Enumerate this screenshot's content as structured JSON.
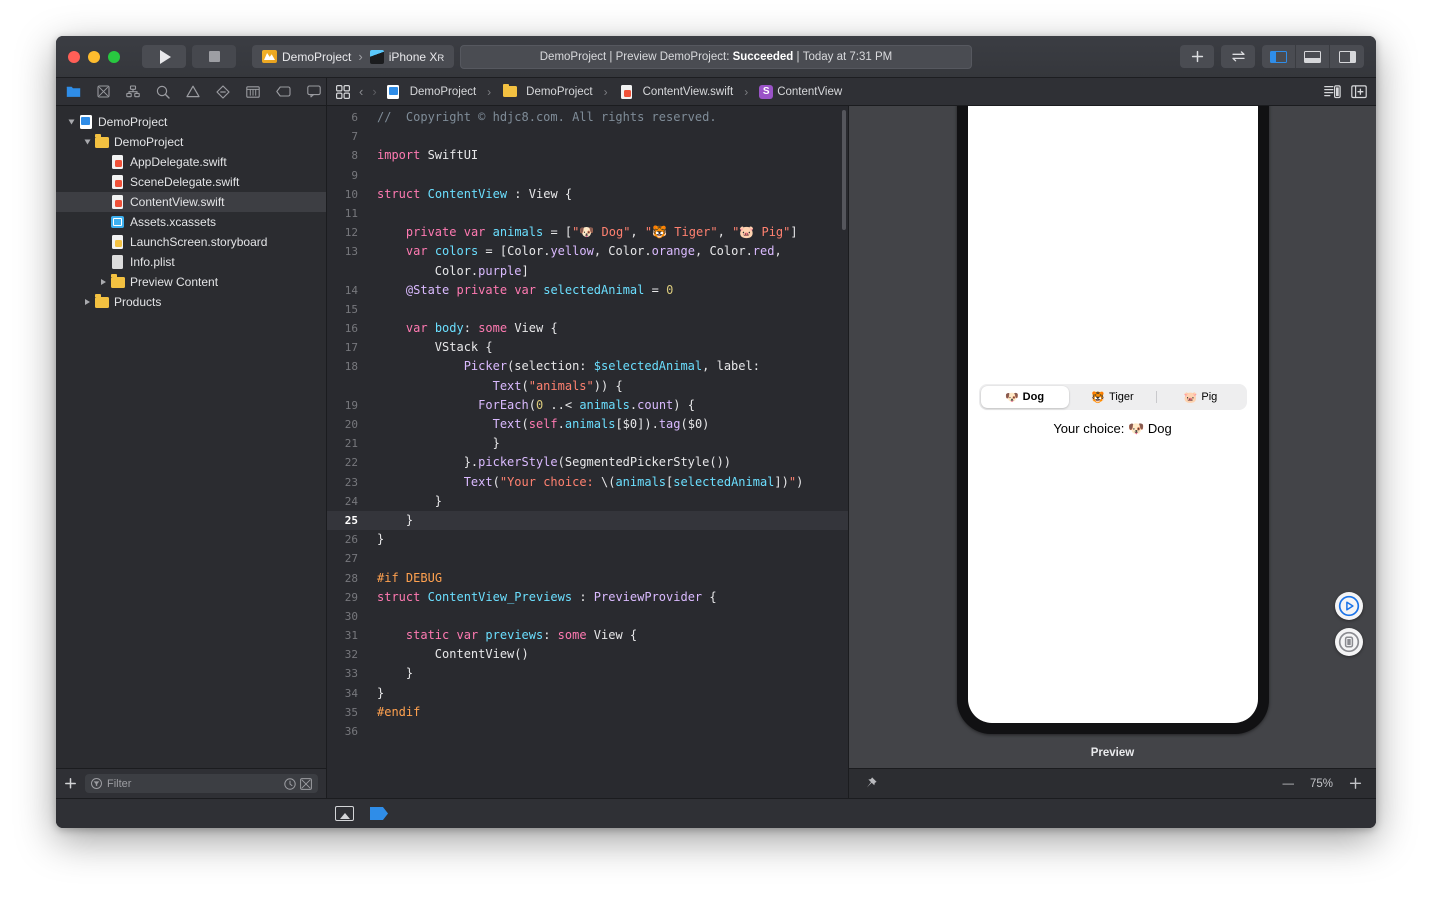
{
  "window": {
    "traffic_lights": [
      "close",
      "minimize",
      "zoom"
    ],
    "status_bar": {
      "project": "DemoProject",
      "separator": "|",
      "action": "Preview DemoProject:",
      "result": "Succeeded",
      "time": "Today at 7:31 PM",
      "full": "DemoProject | Preview DemoProject: Succeeded | Today at 7:31 PM"
    },
    "scheme": {
      "project": "DemoProject",
      "arrow": "›",
      "destination": "iPhone X",
      "destination_suffix": "R"
    },
    "toolbar_right": {
      "add_label": "+",
      "swap_icon": "swap-arrows-icon",
      "panels": [
        "navigator-toggle",
        "debug-area-toggle",
        "inspector-toggle"
      ],
      "active_panel": "navigator-toggle",
      "accent": "#2f8de8"
    },
    "run_button": "run-icon",
    "stop_button": "stop-icon"
  },
  "navigator": {
    "tabs": [
      {
        "name": "project-navigator",
        "active": true
      },
      {
        "name": "source-control-navigator",
        "active": false
      },
      {
        "name": "symbol-navigator",
        "active": false
      },
      {
        "name": "find-navigator",
        "active": false
      },
      {
        "name": "issue-navigator",
        "active": false
      },
      {
        "name": "test-navigator",
        "active": false
      },
      {
        "name": "debug-navigator",
        "active": false
      },
      {
        "name": "breakpoint-navigator",
        "active": false
      },
      {
        "name": "report-navigator",
        "active": false
      }
    ],
    "tree": [
      {
        "label": "DemoProject",
        "icon": "project-icon",
        "depth": 0,
        "twisty": "open",
        "selected": false
      },
      {
        "label": "DemoProject",
        "icon": "folder-icon",
        "depth": 1,
        "twisty": "open",
        "selected": false
      },
      {
        "label": "AppDelegate.swift",
        "icon": "swift-file-icon",
        "depth": 2,
        "twisty": "none",
        "selected": false
      },
      {
        "label": "SceneDelegate.swift",
        "icon": "swift-file-icon",
        "depth": 2,
        "twisty": "none",
        "selected": false
      },
      {
        "label": "ContentView.swift",
        "icon": "swift-file-icon",
        "depth": 2,
        "twisty": "none",
        "selected": true
      },
      {
        "label": "Assets.xcassets",
        "icon": "assets-icon",
        "depth": 2,
        "twisty": "none",
        "selected": false
      },
      {
        "label": "LaunchScreen.storyboard",
        "icon": "storyboard-icon",
        "depth": 2,
        "twisty": "none",
        "selected": false
      },
      {
        "label": "Info.plist",
        "icon": "plist-icon",
        "depth": 2,
        "twisty": "none",
        "selected": false
      },
      {
        "label": "Preview Content",
        "icon": "folder-icon",
        "depth": 2,
        "twisty": "closed",
        "selected": false
      },
      {
        "label": "Products",
        "icon": "folder-icon",
        "depth": 1,
        "twisty": "closed",
        "selected": false
      }
    ],
    "bottom": {
      "add_label": "+",
      "filter_placeholder": "Filter",
      "filter_value": "",
      "recent_icon": "clock-icon",
      "source-control_icon": "source-control-filter-icon"
    }
  },
  "jumpbar": {
    "related_items_icon": "related-items-icon",
    "back": "‹",
    "forward": "›",
    "crumbs": [
      {
        "label": "DemoProject",
        "icon": "project-icon"
      },
      {
        "label": "DemoProject",
        "icon": "folder-icon"
      },
      {
        "label": "ContentView.swift",
        "icon": "swift-file-icon"
      },
      {
        "label": "ContentView",
        "icon": "struct-badge",
        "badge": "S"
      }
    ],
    "right_icons": [
      "editor-options-icon",
      "add-editor-icon"
    ]
  },
  "code": {
    "highlighted_line": 25,
    "lines": [
      {
        "n": 6,
        "tokens": [
          {
            "t": "// ",
            "c": "cm"
          },
          {
            "t": " Copyright © hdjc8.com. All rights reserved.",
            "c": "cm"
          }
        ]
      },
      {
        "n": 7,
        "tokens": []
      },
      {
        "n": 8,
        "tokens": [
          {
            "t": "import",
            "c": "kw"
          },
          {
            "t": " SwiftUI",
            "c": "pl"
          }
        ]
      },
      {
        "n": 9,
        "tokens": []
      },
      {
        "n": 10,
        "tokens": [
          {
            "t": "struct",
            "c": "kw"
          },
          {
            "t": " ",
            "c": "pl"
          },
          {
            "t": "ContentView",
            "c": "ty"
          },
          {
            "t": " : ",
            "c": "pl"
          },
          {
            "t": "View",
            "c": "pl"
          },
          {
            "t": " {",
            "c": "pl"
          }
        ]
      },
      {
        "n": 11,
        "tokens": []
      },
      {
        "n": 12,
        "tokens": [
          {
            "t": "    ",
            "c": "pl"
          },
          {
            "t": "private",
            "c": "kw"
          },
          {
            "t": " ",
            "c": "pl"
          },
          {
            "t": "var",
            "c": "kw"
          },
          {
            "t": " ",
            "c": "pl"
          },
          {
            "t": "animals",
            "c": "ty"
          },
          {
            "t": " = [",
            "c": "pl"
          },
          {
            "t": "\"🐶 Dog\"",
            "c": "str"
          },
          {
            "t": ", ",
            "c": "pl"
          },
          {
            "t": "\"🐯 Tiger\"",
            "c": "str"
          },
          {
            "t": ", ",
            "c": "pl"
          },
          {
            "t": "\"🐷 Pig\"",
            "c": "str"
          },
          {
            "t": "]",
            "c": "pl"
          }
        ]
      },
      {
        "n": 13,
        "tokens": [
          {
            "t": "    ",
            "c": "pl"
          },
          {
            "t": "var",
            "c": "kw"
          },
          {
            "t": " ",
            "c": "pl"
          },
          {
            "t": "colors",
            "c": "ty"
          },
          {
            "t": " = [",
            "c": "pl"
          },
          {
            "t": "Color",
            "c": "pl"
          },
          {
            "t": ".",
            "c": "pl"
          },
          {
            "t": "yellow",
            "c": "fn"
          },
          {
            "t": ", ",
            "c": "pl"
          },
          {
            "t": "Color",
            "c": "pl"
          },
          {
            "t": ".",
            "c": "pl"
          },
          {
            "t": "orange",
            "c": "fn"
          },
          {
            "t": ", ",
            "c": "pl"
          },
          {
            "t": "Color",
            "c": "pl"
          },
          {
            "t": ".",
            "c": "pl"
          },
          {
            "t": "red",
            "c": "fn"
          },
          {
            "t": ",",
            "c": "pl"
          }
        ],
        "cont": [
          {
            "t": "        ",
            "c": "pl"
          },
          {
            "t": "Color",
            "c": "pl"
          },
          {
            "t": ".",
            "c": "pl"
          },
          {
            "t": "purple",
            "c": "fn"
          },
          {
            "t": "]",
            "c": "pl"
          }
        ]
      },
      {
        "n": 14,
        "tokens": [
          {
            "t": "    ",
            "c": "pl"
          },
          {
            "t": "@State",
            "c": "fn"
          },
          {
            "t": " ",
            "c": "pl"
          },
          {
            "t": "private",
            "c": "kw"
          },
          {
            "t": " ",
            "c": "pl"
          },
          {
            "t": "var",
            "c": "kw"
          },
          {
            "t": " ",
            "c": "pl"
          },
          {
            "t": "selectedAnimal",
            "c": "ty"
          },
          {
            "t": " = ",
            "c": "pl"
          },
          {
            "t": "0",
            "c": "num"
          }
        ]
      },
      {
        "n": 15,
        "tokens": []
      },
      {
        "n": 16,
        "tokens": [
          {
            "t": "    ",
            "c": "pl"
          },
          {
            "t": "var",
            "c": "kw"
          },
          {
            "t": " ",
            "c": "pl"
          },
          {
            "t": "body",
            "c": "ty"
          },
          {
            "t": ": ",
            "c": "pl"
          },
          {
            "t": "some",
            "c": "kw"
          },
          {
            "t": " View {",
            "c": "pl"
          }
        ]
      },
      {
        "n": 17,
        "tokens": [
          {
            "t": "        VStack {",
            "c": "pl"
          }
        ]
      },
      {
        "n": 18,
        "tokens": [
          {
            "t": "            ",
            "c": "pl"
          },
          {
            "t": "Picker",
            "c": "fn"
          },
          {
            "t": "(selection: ",
            "c": "pl"
          },
          {
            "t": "$selectedAnimal",
            "c": "ty"
          },
          {
            "t": ", label:",
            "c": "pl"
          }
        ],
        "cont": [
          {
            "t": "                ",
            "c": "pl"
          },
          {
            "t": "Text",
            "c": "fn"
          },
          {
            "t": "(",
            "c": "pl"
          },
          {
            "t": "\"animals\"",
            "c": "str"
          },
          {
            "t": ")) {",
            "c": "pl"
          }
        ]
      },
      {
        "n": 19,
        "tokens": [
          {
            "t": "              ",
            "c": "pl"
          },
          {
            "t": "ForEach",
            "c": "fn"
          },
          {
            "t": "(",
            "c": "pl"
          },
          {
            "t": "0",
            "c": "num"
          },
          {
            "t": " ..< ",
            "c": "pl"
          },
          {
            "t": "animals",
            "c": "ty"
          },
          {
            "t": ".",
            "c": "pl"
          },
          {
            "t": "count",
            "c": "fn"
          },
          {
            "t": ") {",
            "c": "pl"
          }
        ]
      },
      {
        "n": 20,
        "tokens": [
          {
            "t": "                ",
            "c": "pl"
          },
          {
            "t": "Text",
            "c": "fn"
          },
          {
            "t": "(",
            "c": "pl"
          },
          {
            "t": "self",
            "c": "kw"
          },
          {
            "t": ".",
            "c": "pl"
          },
          {
            "t": "animals",
            "c": "ty"
          },
          {
            "t": "[$0]).",
            "c": "pl"
          },
          {
            "t": "tag",
            "c": "fn"
          },
          {
            "t": "($0)",
            "c": "pl"
          }
        ]
      },
      {
        "n": 21,
        "tokens": [
          {
            "t": "                }",
            "c": "pl"
          }
        ]
      },
      {
        "n": 22,
        "tokens": [
          {
            "t": "            }.",
            "c": "pl"
          },
          {
            "t": "pickerStyle",
            "c": "fn"
          },
          {
            "t": "(SegmentedPickerStyle())",
            "c": "pl"
          }
        ]
      },
      {
        "n": 23,
        "tokens": [
          {
            "t": "            ",
            "c": "pl"
          },
          {
            "t": "Text",
            "c": "fn"
          },
          {
            "t": "(",
            "c": "pl"
          },
          {
            "t": "\"Your choice: ",
            "c": "str"
          },
          {
            "t": "\\(",
            "c": "pl"
          },
          {
            "t": "animals",
            "c": "ty"
          },
          {
            "t": "[",
            "c": "pl"
          },
          {
            "t": "selectedAnimal",
            "c": "ty"
          },
          {
            "t": "])",
            "c": "pl"
          },
          {
            "t": "\"",
            "c": "str"
          },
          {
            "t": ")",
            "c": "pl"
          }
        ]
      },
      {
        "n": 24,
        "tokens": [
          {
            "t": "        }",
            "c": "pl"
          }
        ]
      },
      {
        "n": 25,
        "tokens": [
          {
            "t": "    }",
            "c": "pl"
          }
        ]
      },
      {
        "n": 26,
        "tokens": [
          {
            "t": "}",
            "c": "pl"
          }
        ]
      },
      {
        "n": 27,
        "tokens": []
      },
      {
        "n": 28,
        "tokens": [
          {
            "t": "#if",
            "c": "pre"
          },
          {
            "t": " ",
            "c": "pl"
          },
          {
            "t": "DEBUG",
            "c": "pre"
          }
        ]
      },
      {
        "n": 29,
        "tokens": [
          {
            "t": "struct",
            "c": "kw"
          },
          {
            "t": " ",
            "c": "pl"
          },
          {
            "t": "ContentView_Previews",
            "c": "ty"
          },
          {
            "t": " : ",
            "c": "pl"
          },
          {
            "t": "PreviewProvider",
            "c": "fn"
          },
          {
            "t": " {",
            "c": "pl"
          }
        ]
      },
      {
        "n": 30,
        "tokens": []
      },
      {
        "n": 31,
        "tokens": [
          {
            "t": "    ",
            "c": "pl"
          },
          {
            "t": "static",
            "c": "kw"
          },
          {
            "t": " ",
            "c": "pl"
          },
          {
            "t": "var",
            "c": "kw"
          },
          {
            "t": " ",
            "c": "pl"
          },
          {
            "t": "previews",
            "c": "ty"
          },
          {
            "t": ": ",
            "c": "pl"
          },
          {
            "t": "some",
            "c": "kw"
          },
          {
            "t": " View {",
            "c": "pl"
          }
        ]
      },
      {
        "n": 32,
        "tokens": [
          {
            "t": "        ContentView()",
            "c": "pl"
          }
        ]
      },
      {
        "n": 33,
        "tokens": [
          {
            "t": "    }",
            "c": "pl"
          }
        ]
      },
      {
        "n": 34,
        "tokens": [
          {
            "t": "}",
            "c": "pl"
          }
        ]
      },
      {
        "n": 35,
        "tokens": [
          {
            "t": "#endif",
            "c": "pre"
          }
        ]
      },
      {
        "n": 36,
        "tokens": []
      }
    ]
  },
  "canvas": {
    "device": "iPhone XR",
    "preview_label": "Preview",
    "picker": {
      "segments": [
        {
          "emoji": "🐶",
          "label": "Dog",
          "selected": true
        },
        {
          "emoji": "🐯",
          "label": "Tiger",
          "selected": false
        },
        {
          "emoji": "🐷",
          "label": "Pig",
          "selected": false
        }
      ]
    },
    "choice_prefix": "Your choice:",
    "choice_emoji": "🐶",
    "choice_value": "Dog",
    "controls": [
      {
        "name": "live-preview-play-button",
        "icon": "play-circle-icon",
        "color": "#1a73e8"
      },
      {
        "name": "preview-on-device-button",
        "icon": "device-circle-icon",
        "color": "#8a8b90"
      }
    ],
    "bottom_bar": {
      "pin_icon": "pin-icon",
      "zoom_out": "—",
      "zoom_level": "75%",
      "zoom_in": "+"
    }
  },
  "debug_bar": {
    "icons": [
      "show-debug-area-icon",
      "breakpoints-flag-icon"
    ],
    "breakpoints_active": true
  }
}
